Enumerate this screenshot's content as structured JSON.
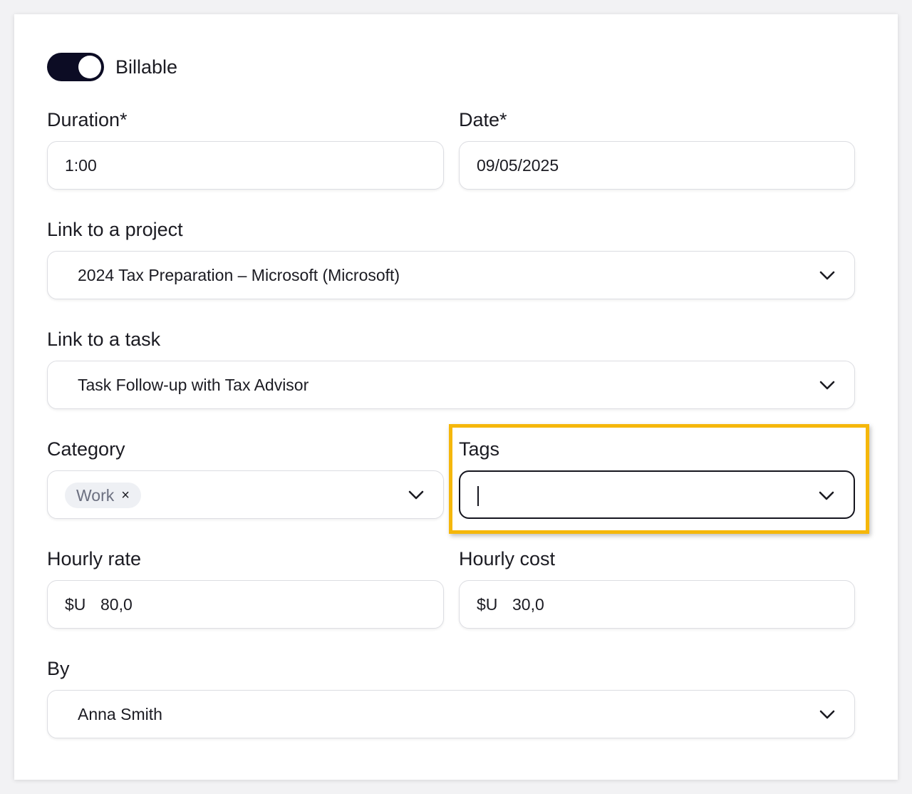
{
  "billable": {
    "label": "Billable",
    "on": true
  },
  "duration": {
    "label": "Duration*",
    "value": "1:00"
  },
  "date": {
    "label": "Date*",
    "value": "09/05/2025"
  },
  "project": {
    "label": "Link to a project",
    "value": "2024 Tax Preparation – Microsoft (Microsoft)"
  },
  "task": {
    "label": "Link to a task",
    "value": "Task Follow-up with Tax Advisor"
  },
  "category": {
    "label": "Category",
    "chip": "Work",
    "chip_remove": "×"
  },
  "tags": {
    "label": "Tags",
    "value": ""
  },
  "hourly_rate": {
    "label": "Hourly rate",
    "currency": "$U",
    "value": "80,0"
  },
  "hourly_cost": {
    "label": "Hourly cost",
    "currency": "$U",
    "value": "30,0"
  },
  "by": {
    "label": "By",
    "value": "Anna Smith"
  },
  "colors": {
    "toggle_on": "#0c0c24",
    "highlight": "#f5b70a",
    "border": "#dcdde2"
  }
}
